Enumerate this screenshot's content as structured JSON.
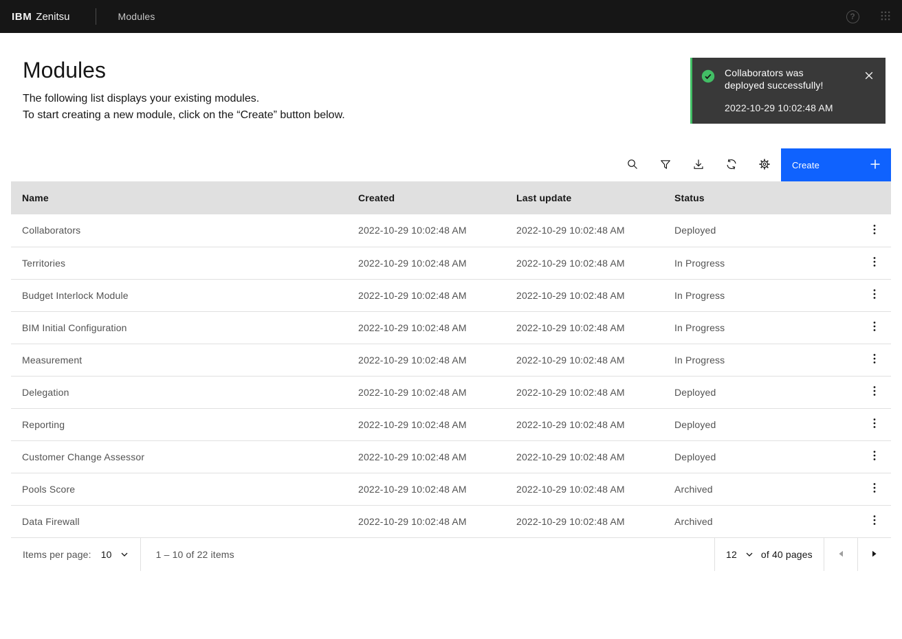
{
  "header": {
    "brand": "IBM",
    "product": "Zenitsu",
    "nav": "Modules"
  },
  "toast": {
    "message": "Collaborators was deployed successfully!",
    "timestamp": "2022-10-29 10:02:48 AM"
  },
  "page": {
    "title": "Modules",
    "description_line1": "The following list displays your existing modules.",
    "description_line2": "To start creating a new module, click on the “Create” button below."
  },
  "toolbar": {
    "create_label": "Create",
    "icon_names": [
      "search-icon",
      "filter-icon",
      "download-icon",
      "renew-icon",
      "settings-icon"
    ]
  },
  "table": {
    "columns": [
      "Name",
      "Created",
      "Last update",
      "Status"
    ],
    "rows": [
      {
        "name": "Collaborators",
        "created": "2022-10-29 10:02:48 AM",
        "last_update": "2022-10-29 10:02:48 AM",
        "status": "Deployed"
      },
      {
        "name": "Territories",
        "created": "2022-10-29 10:02:48 AM",
        "last_update": "2022-10-29 10:02:48 AM",
        "status": "In Progress"
      },
      {
        "name": "Budget Interlock Module",
        "created": "2022-10-29 10:02:48 AM",
        "last_update": "2022-10-29 10:02:48 AM",
        "status": "In Progress"
      },
      {
        "name": "BIM Initial Configuration",
        "created": "2022-10-29 10:02:48 AM",
        "last_update": "2022-10-29 10:02:48 AM",
        "status": "In Progress"
      },
      {
        "name": "Measurement",
        "created": "2022-10-29 10:02:48 AM",
        "last_update": "2022-10-29 10:02:48 AM",
        "status": "In Progress"
      },
      {
        "name": "Delegation",
        "created": "2022-10-29 10:02:48 AM",
        "last_update": "2022-10-29 10:02:48 AM",
        "status": "Deployed"
      },
      {
        "name": "Reporting",
        "created": "2022-10-29 10:02:48 AM",
        "last_update": "2022-10-29 10:02:48 AM",
        "status": "Deployed"
      },
      {
        "name": "Customer Change Assessor",
        "created": "2022-10-29 10:02:48 AM",
        "last_update": "2022-10-29 10:02:48 AM",
        "status": "Deployed"
      },
      {
        "name": "Pools Score",
        "created": "2022-10-29 10:02:48 AM",
        "last_update": "2022-10-29 10:02:48 AM",
        "status": "Archived"
      },
      {
        "name": "Data Firewall",
        "created": "2022-10-29 10:02:48 AM",
        "last_update": "2022-10-29 10:02:48 AM",
        "status": "Archived"
      }
    ]
  },
  "pagination": {
    "items_per_page_label": "Items per page:",
    "items_per_page_value": "10",
    "range_text": "1 – 10 of 22 items",
    "page_value": "12",
    "pages_label": "of 40 pages"
  },
  "icons": {
    "help_glyph": "?"
  },
  "colors": {
    "header_bg": "#161616",
    "accent": "#0f62fe",
    "success": "#42be65",
    "toast_bg": "#393939",
    "table_header_bg": "#e0e0e0",
    "border": "#e0e0e0",
    "text_primary": "#161616",
    "text_secondary": "#525252"
  }
}
